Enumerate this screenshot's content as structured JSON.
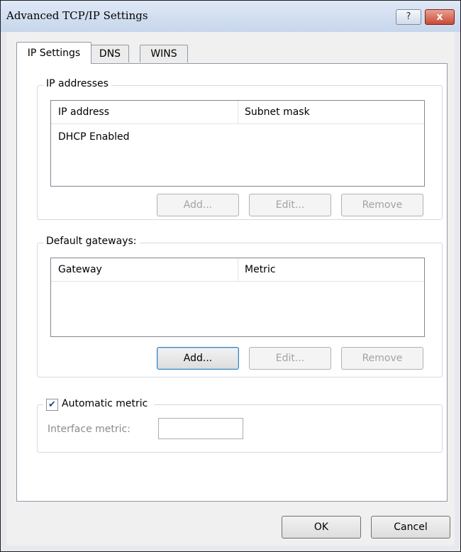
{
  "window": {
    "title": "Advanced TCP/IP Settings",
    "help_label": "?",
    "close_label": "x"
  },
  "tabs": [
    {
      "label": "IP Settings"
    },
    {
      "label": "DNS"
    },
    {
      "label": "WINS"
    }
  ],
  "ip_addresses": {
    "legend": "IP addresses",
    "columns": [
      "IP address",
      "Subnet mask"
    ],
    "rows": [
      {
        "ip": "DHCP Enabled",
        "mask": ""
      }
    ],
    "add_label": "Add...",
    "edit_label": "Edit...",
    "remove_label": "Remove"
  },
  "gateways": {
    "legend": "Default gateways:",
    "columns": [
      "Gateway",
      "Metric"
    ],
    "rows": [],
    "add_label": "Add...",
    "edit_label": "Edit...",
    "remove_label": "Remove"
  },
  "metric": {
    "automatic_label": "Automatic metric",
    "automatic_checked": true,
    "check_glyph": "✔",
    "interface_label": "Interface metric:",
    "interface_value": ""
  },
  "footer": {
    "ok_label": "OK",
    "cancel_label": "Cancel"
  }
}
